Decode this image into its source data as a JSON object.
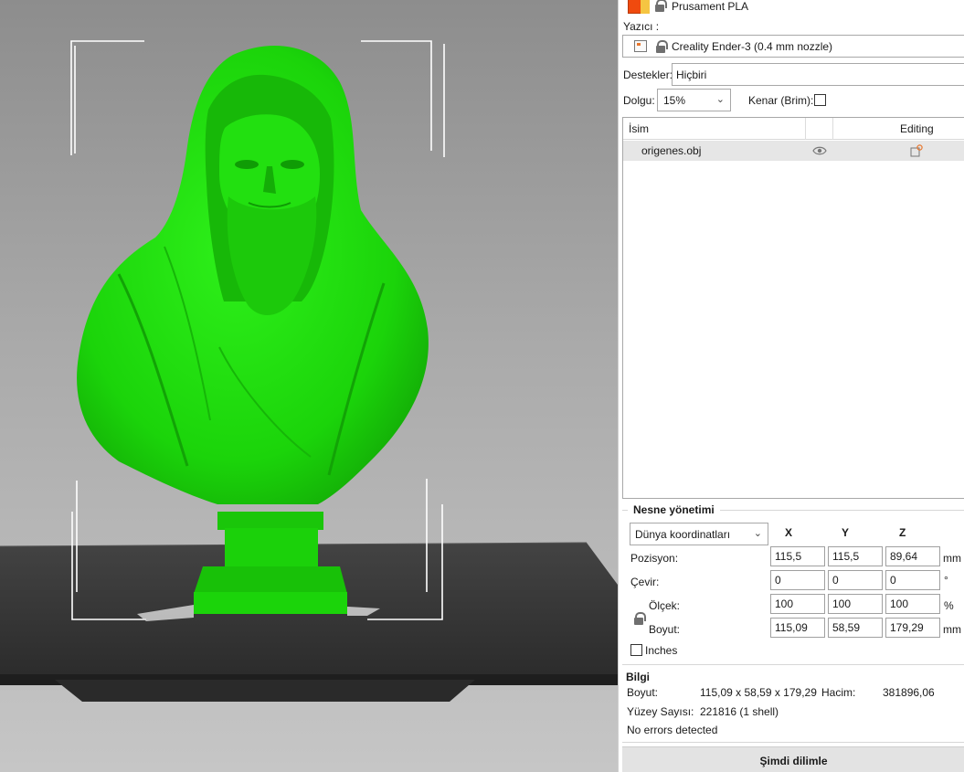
{
  "filament": {
    "name": "Prusament PLA",
    "color": "#f04a0e"
  },
  "printer": {
    "label": "Yazıcı :",
    "name": "Creality Ender-3 (0.4 mm nozzle)"
  },
  "supports": {
    "label": "Destekler:",
    "value": "Hiçbiri"
  },
  "infill": {
    "label": "Dolgu:",
    "value": "15%",
    "brim_label": "Kenar (Brim):",
    "brim_checked": false
  },
  "object_list": {
    "headers": {
      "name": "İsim",
      "editing": "Editing"
    },
    "rows": [
      {
        "name": "origenes.obj",
        "visible": true
      }
    ]
  },
  "object_manipulation": {
    "title": "Nesne yönetimi",
    "coord_system": "Dünya koordinatları",
    "axes": [
      "X",
      "Y",
      "Z"
    ],
    "position": {
      "label": "Pozisyon:",
      "values": [
        "115,5",
        "115,5",
        "89,64"
      ],
      "unit": "mm"
    },
    "rotation": {
      "label": "Çevir:",
      "values": [
        "0",
        "0",
        "0"
      ],
      "unit": "°"
    },
    "scale": {
      "label": "Ölçek:",
      "values": [
        "100",
        "100",
        "100"
      ],
      "unit": "%"
    },
    "size": {
      "label": "Boyut:",
      "values": [
        "115,09",
        "58,59",
        "179,29"
      ],
      "unit": "mm"
    },
    "inches_label": "Inches"
  },
  "info": {
    "title": "Bilgi",
    "size_label": "Boyut:",
    "size_value": "115,09 x 58,59 x 179,29",
    "volume_label": "Hacim:",
    "volume_value": "381896,06",
    "facets_label": "Yüzey Sayısı:",
    "facets_value": "221816 (1 shell)",
    "errors": "No errors detected"
  },
  "slice_button": "Şimdi dilimle",
  "colors": {
    "model": "#1fd80a",
    "bed": "#3a3a3a",
    "accent": "#e8762c"
  }
}
